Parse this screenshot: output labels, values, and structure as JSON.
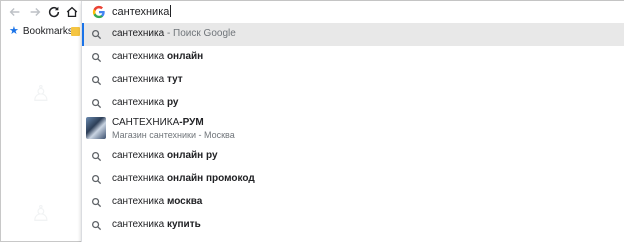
{
  "toolbar": {
    "back_icon": "arrow-left-icon",
    "forward_icon": "arrow-right-icon",
    "reload_icon": "reload-icon",
    "home_icon": "home-icon"
  },
  "bookmarks": {
    "label": "Bookmarks",
    "icon": "star-icon"
  },
  "omnibox": {
    "engine_icon": "google-g-icon",
    "query": "сантехника"
  },
  "suggestions": [
    {
      "prefix": "сантехника",
      "bold": "",
      "hint": " - Поиск Google",
      "selected": true
    },
    {
      "prefix": "сантехника ",
      "bold": "онлайн",
      "hint": ""
    },
    {
      "prefix": "сантехника ",
      "bold": "тут",
      "hint": ""
    },
    {
      "prefix": "сантехника ",
      "bold": "ру",
      "hint": ""
    }
  ],
  "entity": {
    "title_prefix": "САНТЕХНИКА",
    "title_bold": "-РУМ",
    "subtitle": "Магазин сантехники - Москва"
  },
  "more_suggestions": [
    {
      "prefix": "сантехника ",
      "bold": "онлайн ру"
    },
    {
      "prefix": "сантехника ",
      "bold": "онлайн промокод"
    },
    {
      "prefix": "сантехника ",
      "bold": "москва"
    },
    {
      "prefix": "сантехника ",
      "bold": "купить"
    }
  ],
  "colors": {
    "accent": "#1a73e8",
    "selected_bg": "#e8e8e8",
    "hint": "#70757a"
  }
}
